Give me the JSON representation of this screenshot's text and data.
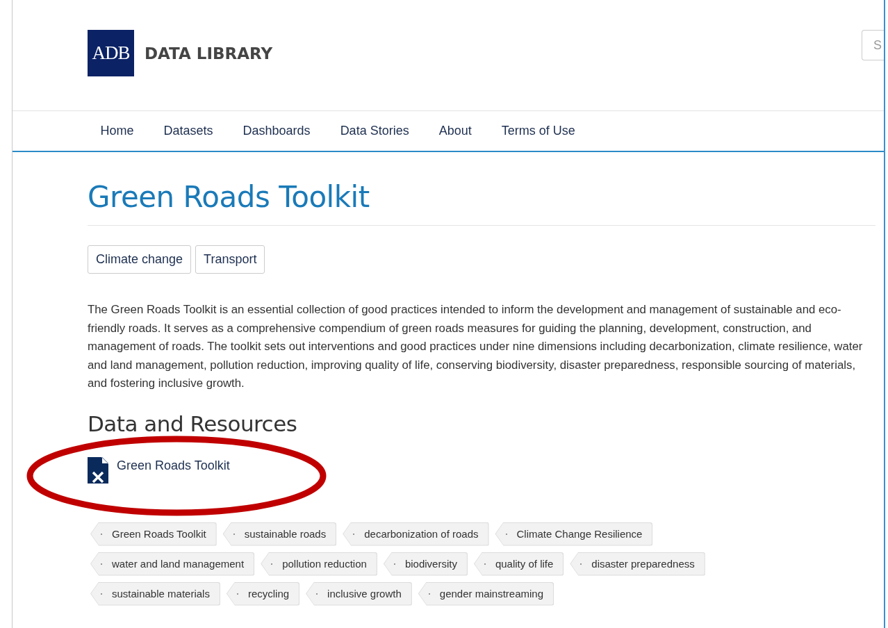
{
  "header": {
    "logo_mark": "ADB",
    "logo_text": "DATA LIBRARY",
    "search": {
      "placeholder": "S"
    }
  },
  "nav": [
    {
      "label": "Home"
    },
    {
      "label": "Datasets"
    },
    {
      "label": "Dashboards"
    },
    {
      "label": "Data Stories"
    },
    {
      "label": "About"
    },
    {
      "label": "Terms of Use"
    }
  ],
  "title": "Green Roads Toolkit",
  "groups": [
    "Climate change",
    "Transport"
  ],
  "description": "The Green Roads Toolkit is an essential collection of good practices intended to inform the development and management of sustainable and eco-friendly roads. It serves as a comprehensive compendium of green roads measures for guiding the planning, development, construction, and management of roads. The toolkit sets out interventions and good practices under nine dimensions including decarbonization, climate resilience, water and land management, pollution reduction, improving quality of life, conserving biodiversity, disaster preparedness, responsible sourcing of materials, and fostering inclusive growth.",
  "resources": {
    "heading": "Data and Resources",
    "items": [
      {
        "name": "Green Roads Toolkit",
        "kind": "spreadsheet",
        "highlighted": true
      }
    ]
  },
  "tags": [
    [
      "Green Roads Toolkit",
      "sustainable roads",
      "decarbonization of roads",
      "Climate Change Resilience"
    ],
    [
      "water and land management",
      "pollution reduction",
      "biodiversity",
      "quality of life",
      "disaster preparedness"
    ],
    [
      "sustainable materials",
      "recycling",
      "inclusive growth",
      "gender mainstreaming"
    ]
  ]
}
